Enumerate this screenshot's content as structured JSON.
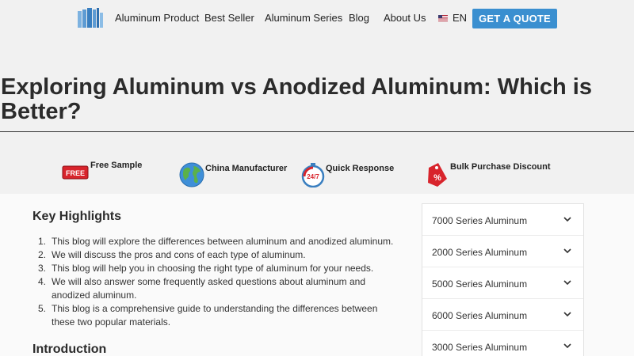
{
  "nav": {
    "items": [
      "Aluminum Product",
      "Best Seller",
      "Aluminum Series",
      "Blog",
      "About Us"
    ],
    "lang": "EN",
    "quote": "GET A QUOTE"
  },
  "article": {
    "title": "Exploring Aluminum vs Anodized Aluminum: Which is Better?"
  },
  "features": [
    {
      "label": "Free Sample",
      "icon": "free-badge-icon",
      "badge_text": "FREE"
    },
    {
      "label": "China Manufacturer",
      "icon": "globe-icon"
    },
    {
      "label": "Quick Response",
      "icon": "stopwatch-24-7-icon",
      "badge_text": "24/7"
    },
    {
      "label": "Bulk Purchase Discount",
      "icon": "discount-tag-icon",
      "badge_text": "%"
    }
  ],
  "highlights": {
    "heading": "Key Highlights",
    "items": [
      "This blog will explore the differences between aluminum and anodized aluminum.",
      "We will discuss the pros and cons of each type of aluminum.",
      "This blog will help you in choosing the right type of aluminum for your needs.",
      "We will also answer some frequently asked questions about aluminum and anodized aluminum.",
      "This blog is a comprehensive guide to understanding the differences between these two popular materials."
    ]
  },
  "intro": {
    "heading": "Introduction"
  },
  "sidebar": {
    "series": [
      "7000 Series Aluminum",
      "2000 Series Aluminum",
      "5000 Series Aluminum",
      "6000 Series Aluminum",
      "3000 Series Aluminum"
    ]
  },
  "colors": {
    "accent": "#3a8fd0",
    "badge_red": "#d8242c"
  }
}
